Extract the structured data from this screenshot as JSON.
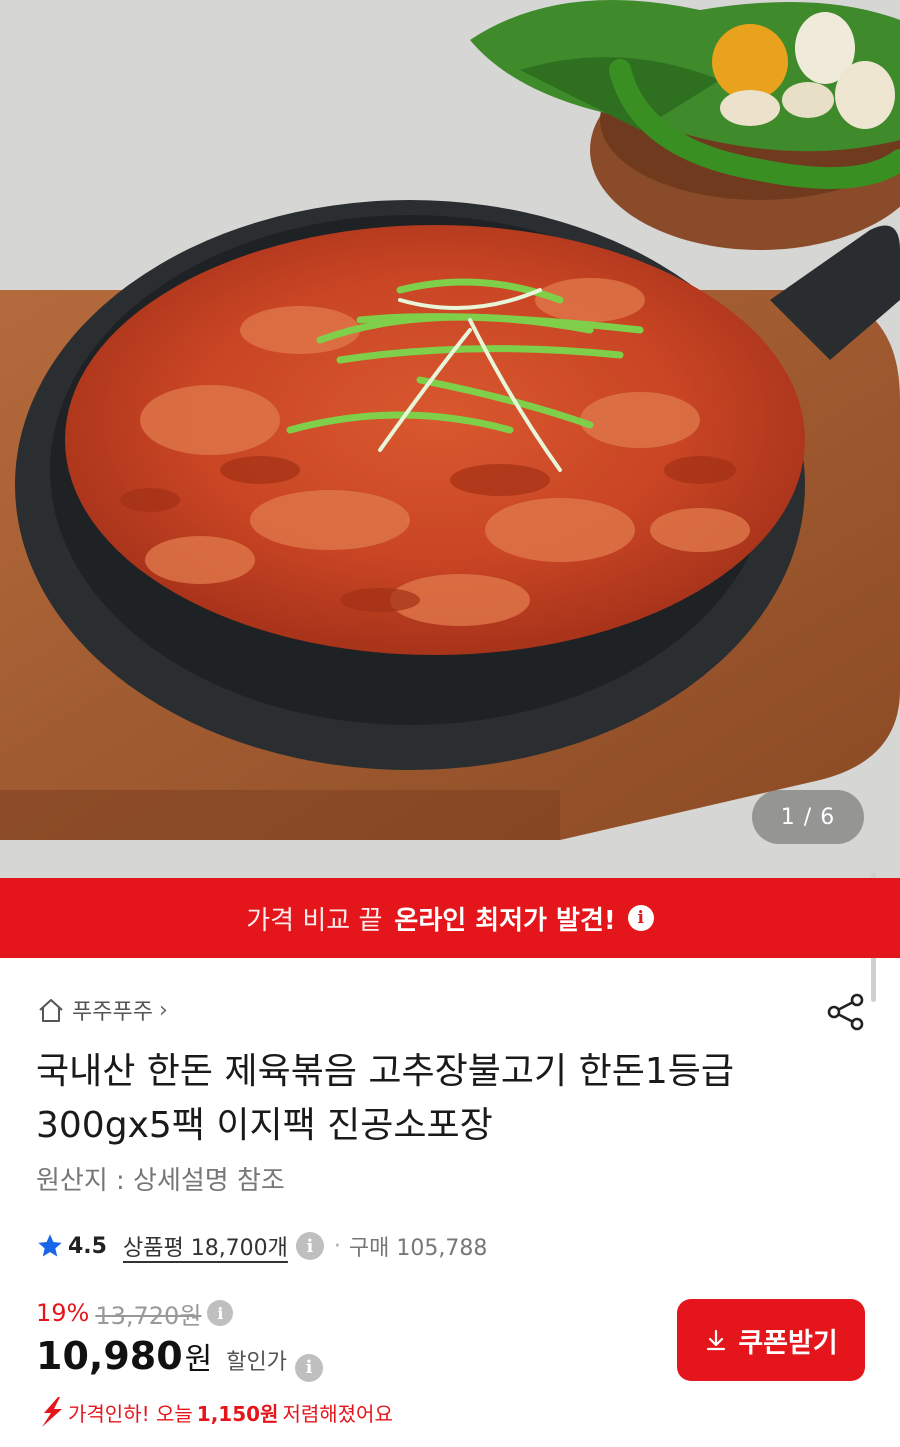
{
  "gallery": {
    "counter": "1 / 6",
    "image_alt": "spicy stir-fried pork in cast iron skillet on wooden board"
  },
  "banner": {
    "light_text": "가격 비교 끝",
    "bold_text": "온라인 최저가 발견!",
    "info_glyph": "i"
  },
  "store": {
    "name": "푸주푸주",
    "chevron": "›"
  },
  "product": {
    "title": "국내산 한돈 제육볶음 고추장불고기 한돈1등급 300gx5팩 이지팩 진공소포장",
    "origin": "원산지 : 상세설명 참조"
  },
  "rating": {
    "score": "4.5",
    "reviews": "상품평 18,700개",
    "separator": "·",
    "purchases": "구매 105,788"
  },
  "price": {
    "discount_rate": "19%",
    "original": "13,720원",
    "sale_number": "10,980",
    "sale_unit": "원",
    "sale_label": "할인가",
    "drop_prefix": "가격인하! 오늘",
    "drop_amount": "1,150원",
    "drop_suffix": "저렴해졌어요"
  },
  "coupon": {
    "label": "쿠폰받기"
  },
  "colors": {
    "accent": "#e5161b",
    "star": "#1a66e8",
    "muted": "#777777"
  }
}
